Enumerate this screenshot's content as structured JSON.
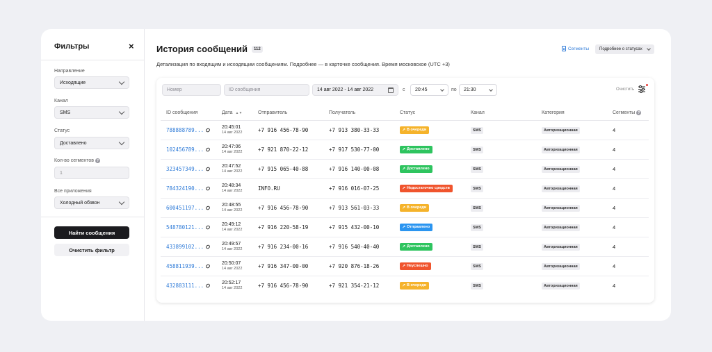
{
  "sidebar": {
    "title": "Фильтры",
    "close_icon": "×",
    "direction_label": "Направление",
    "direction_value": "Исходящие",
    "channel_label": "Канал",
    "channel_value": "SMS",
    "status_label": "Статус",
    "status_value": "Доставлено",
    "segments_label": "Кол-во сегментов",
    "segments_value": "1",
    "apps_label": "Все приложения",
    "apps_value": "Холодный обзвон",
    "find_button": "Найти сообщения",
    "clear_button": "Очистить фильтр"
  },
  "header": {
    "title": "История сообщений",
    "count": "112",
    "segments_link": "Сегменты",
    "status_info": "Подробнее о статусах",
    "subtitle": "Детализация по входящим и исходящим сообщениям. Подробнее — в карточке сообщения. Время московское (UTC +3)"
  },
  "filters": {
    "number_placeholder": "Номер",
    "id_placeholder": "ID сообщения",
    "date_range": "14 авг 2022 - 14 авг 2022",
    "from_word": "с",
    "from_time": "20:45",
    "to_word": "по",
    "to_time": "21:30",
    "clear": "Очистить"
  },
  "table": {
    "columns": [
      "ID сообщения",
      "Дата",
      "Отправитель",
      "Получатель",
      "Статус",
      "Канал",
      "Категория",
      "Сегменты"
    ],
    "rows": [
      {
        "id": "788888789...",
        "time": "20:45:01",
        "date": "14 авг 2022",
        "sender": "+7 916 456-78-90",
        "receiver": "+7 913 380-33-33",
        "status": "В очереди",
        "status_color": "#f5b32b",
        "channel": "SMS",
        "category": "Авторизационная",
        "segments": "4"
      },
      {
        "id": "102456789...",
        "time": "20:47:06",
        "date": "14 авг 2022",
        "sender": "+7 921 870-22-12",
        "receiver": "+7 917 530-77-00",
        "status": "Доставлено",
        "status_color": "#2ec45f",
        "channel": "SMS",
        "category": "Авторизационная",
        "segments": "4"
      },
      {
        "id": "323457349...",
        "time": "20:47:52",
        "date": "14 авг 2022",
        "sender": "+7 915 065-40-88",
        "receiver": "+7 916 140-00-08",
        "status": "Доставлено",
        "status_color": "#2ec45f",
        "channel": "SMS",
        "category": "Авторизационная",
        "segments": "4"
      },
      {
        "id": "784324190...",
        "time": "20:48:34",
        "date": "14 авг 2022",
        "sender": "INFO.RU",
        "receiver": "+7 916 016-07-25",
        "status": "Недостаточно средств",
        "status_color": "#f0542d",
        "channel": "SMS",
        "category": "Авторизационная",
        "segments": "4"
      },
      {
        "id": "600451197...",
        "time": "20:48:55",
        "date": "14 авг 2022",
        "sender": "+7 916 456-78-90",
        "receiver": "+7 913 561-03-33",
        "status": "В очереди",
        "status_color": "#f5b32b",
        "channel": "SMS",
        "category": "Авторизационная",
        "segments": "4"
      },
      {
        "id": "548780121...",
        "time": "20:49:12",
        "date": "14 авг 2022",
        "sender": "+7 916 220-58-19",
        "receiver": "+7 915 432-00-10",
        "status": "Отправлено",
        "status_color": "#2b95f0",
        "channel": "SMS",
        "category": "Авторизационная",
        "segments": "4"
      },
      {
        "id": "433899102...",
        "time": "20:49:57",
        "date": "14 авг 2022",
        "sender": "+7 916 234-00-16",
        "receiver": "+7 916 540-40-40",
        "status": "Доставлено",
        "status_color": "#2ec45f",
        "channel": "SMS",
        "category": "Авторизационная",
        "segments": "4"
      },
      {
        "id": "458811939...",
        "time": "20:50:07",
        "date": "14 авг 2022",
        "sender": "+7 916 347-00-00",
        "receiver": "+7 920 876-18-26",
        "status": "Неуспешно",
        "status_color": "#f0542d",
        "channel": "SMS",
        "category": "Авторизационная",
        "segments": "4"
      },
      {
        "id": "432883111...",
        "time": "20:52:17",
        "date": "14 авг 2022",
        "sender": "+7 916 456-78-90",
        "receiver": "+7 921 354-21-12",
        "status": "В очереди",
        "status_color": "#f5b32b",
        "channel": "SMS",
        "category": "Авторизационная",
        "segments": "4"
      }
    ]
  }
}
